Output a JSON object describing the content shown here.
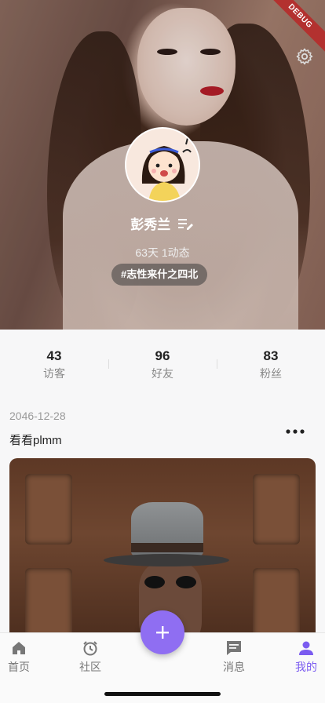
{
  "debug_banner": "DEBUG",
  "profile": {
    "name": "彭秀兰",
    "stats_line": "63天 1动态",
    "tag": "#志性来什之四北"
  },
  "counters": [
    {
      "value": "43",
      "label": "访客"
    },
    {
      "value": "96",
      "label": "好友"
    },
    {
      "value": "83",
      "label": "粉丝"
    }
  ],
  "post": {
    "date": "2046-12-28",
    "text": "看看plmm"
  },
  "tabbar": {
    "items": [
      {
        "label": "首页",
        "icon": "home-icon"
      },
      {
        "label": "社区",
        "icon": "alarm-clock-icon"
      },
      {
        "label": "消息",
        "icon": "message-icon"
      },
      {
        "label": "我的",
        "icon": "person-icon"
      }
    ],
    "active": "我的",
    "fab_icon": "plus-icon"
  },
  "colors": {
    "accent": "#8f6ef2",
    "active_tab": "#7b5cf0",
    "debug": "#b3312f"
  }
}
